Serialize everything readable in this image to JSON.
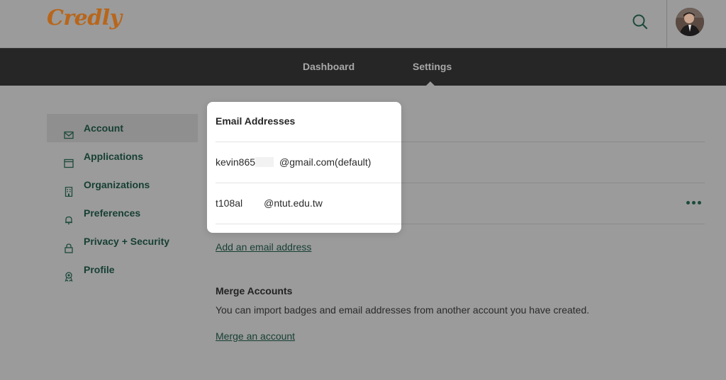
{
  "header": {
    "logo_text": "Credly",
    "search_icon": "search-icon",
    "avatar_icon": "user-avatar",
    "brand_color": "#b8661b"
  },
  "nav": {
    "dashboard_label": "Dashboard",
    "settings_label": "Settings"
  },
  "sidebar": {
    "items": [
      {
        "label": "Account",
        "icon": "envelope-icon",
        "active": true
      },
      {
        "label": "Applications",
        "icon": "browser-window-icon",
        "active": false
      },
      {
        "label": "Organizations",
        "icon": "building-icon",
        "active": false
      },
      {
        "label": "Preferences",
        "icon": "bell-icon",
        "active": false
      },
      {
        "label": "Privacy + Security",
        "icon": "lock-icon",
        "active": false
      },
      {
        "label": "Profile",
        "icon": "profile-badge-icon",
        "active": false
      }
    ]
  },
  "email_popup": {
    "title": "Email Addresses",
    "emails": [
      {
        "prefix": "kevin865",
        "suffix": "@gmail.com(default)"
      },
      {
        "prefix": "t108al",
        "suffix": "@ntut.edu.tw"
      }
    ]
  },
  "main": {
    "add_email_link": "Add an email address",
    "more_icon": "more-options-icon",
    "merge_title": "Merge Accounts",
    "merge_description": "You can import badges and email addresses from another account you have created.",
    "merge_link": "Merge an account"
  }
}
